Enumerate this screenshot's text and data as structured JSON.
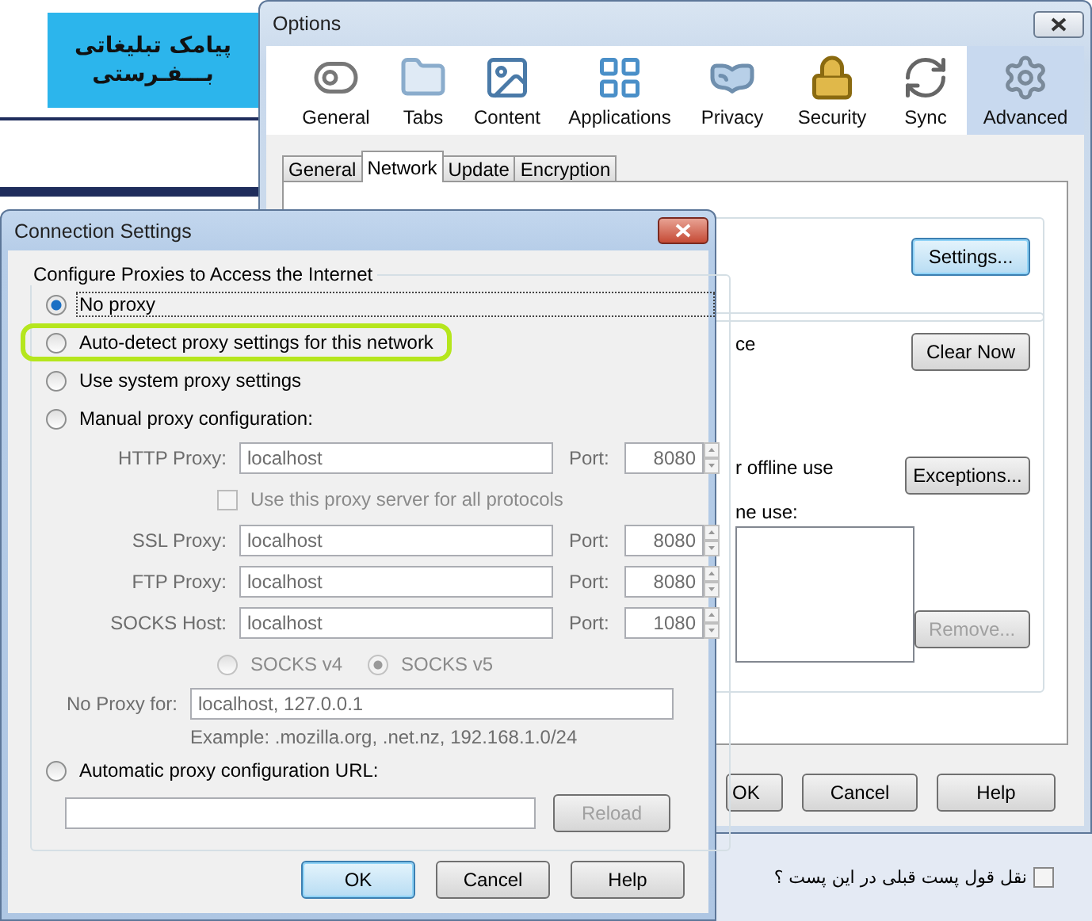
{
  "background_page": {
    "banner": {
      "lines": [
        "پیامک تبلیغاتی",
        "بـــفـرستی"
      ]
    },
    "quote_checkbox": {
      "label": "نقل قول پست قبلی در این پست ؟",
      "checked": false
    }
  },
  "options_window": {
    "title": "Options",
    "panes": [
      {
        "label": "General",
        "selected": false
      },
      {
        "label": "Tabs",
        "selected": false
      },
      {
        "label": "Content",
        "selected": false
      },
      {
        "label": "Applications",
        "selected": false
      },
      {
        "label": "Privacy",
        "selected": false
      },
      {
        "label": "Security",
        "selected": false
      },
      {
        "label": "Sync",
        "selected": false
      },
      {
        "label": "Advanced",
        "selected": true
      }
    ],
    "tabs": [
      {
        "label": "General",
        "selected": false
      },
      {
        "label": "Network",
        "selected": true
      },
      {
        "label": "Update",
        "selected": false
      },
      {
        "label": "Encryption",
        "selected": false
      }
    ],
    "connection_group": {
      "button": "Settings..."
    },
    "storage_group": {
      "cache_text": "ce",
      "clear_button": "Clear Now",
      "offline_text": "r offline use",
      "exceptions_button": "Exceptions...",
      "list_label": "ne use:",
      "remove_button": {
        "label": "Remove...",
        "disabled": true
      }
    },
    "buttons": [
      "OK",
      "Cancel",
      "Help"
    ]
  },
  "connection_settings": {
    "title": "Connection Settings",
    "group_label": "Configure Proxies to Access the Internet",
    "modes": [
      {
        "kind": "plain",
        "label": "No proxy",
        "selected": true,
        "focused": true,
        "highlighted": false
      },
      {
        "kind": "plain",
        "label": "Auto-detect proxy settings for this network",
        "selected": false,
        "focused": false,
        "highlighted": true
      },
      {
        "kind": "plain",
        "label": "Use system proxy settings",
        "selected": false,
        "focused": false,
        "highlighted": false
      },
      {
        "kind": "manual",
        "label": "Manual proxy configuration:",
        "selected": false,
        "focused": false,
        "highlighted": false
      },
      {
        "kind": "auto_url",
        "label": "Automatic proxy configuration URL:",
        "selected": false,
        "focused": false,
        "highlighted": false
      }
    ],
    "manual": {
      "disabled": true,
      "http": {
        "label": "HTTP Proxy:",
        "value": "localhost",
        "port_label": "Port:",
        "port": "8080"
      },
      "share_checkbox": {
        "label": "Use this proxy server for all protocols",
        "checked": false
      },
      "proxies": [
        {
          "label": "SSL Proxy:",
          "value": "localhost",
          "port_label": "Port:",
          "port": "8080"
        },
        {
          "label": "FTP Proxy:",
          "value": "localhost",
          "port_label": "Port:",
          "port": "8080"
        },
        {
          "label": "SOCKS Host:",
          "value": "localhost",
          "port_label": "Port:",
          "port": "1080"
        }
      ],
      "socks_versions": [
        {
          "label": "SOCKS v4",
          "selected": false
        },
        {
          "label": "SOCKS v5",
          "selected": true
        }
      ],
      "no_proxy": {
        "label": "No Proxy for:",
        "value": "localhost, 127.0.0.1"
      },
      "example": "Example: .mozilla.org, .net.nz, 192.168.1.0/24"
    },
    "auto_url": {
      "reload_button": "Reload",
      "reload_disabled": true
    },
    "buttons": [
      {
        "label": "OK",
        "default": true
      },
      {
        "label": "Cancel",
        "default": false
      },
      {
        "label": "Help",
        "default": false
      }
    ]
  }
}
